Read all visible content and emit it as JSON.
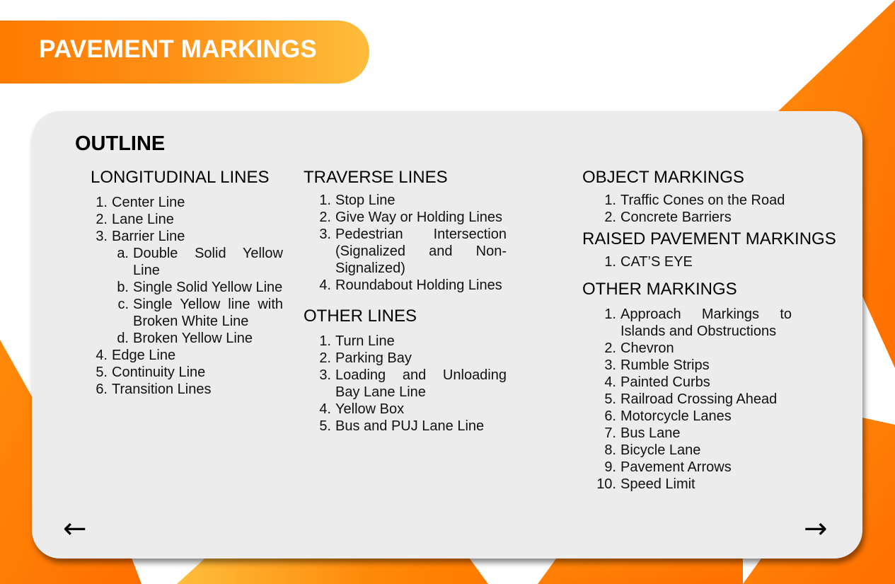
{
  "header": {
    "title": "PAVEMENT MARKINGS"
  },
  "outline": {
    "title": "OUTLINE",
    "longitudinal": {
      "heading": "LONGITUDINAL LINES",
      "items": [
        {
          "num": "1.",
          "text": "Center Line"
        },
        {
          "num": "2.",
          "text": "Lane Line"
        },
        {
          "num": "3.",
          "text": "Barrier Line"
        },
        {
          "num": "4.",
          "text": "Edge Line"
        },
        {
          "num": "5.",
          "text": "Continuity Line"
        },
        {
          "num": "6.",
          "text": "Transition Lines"
        }
      ],
      "subitems": [
        {
          "num": "a.",
          "text": "Double Solid Yellow Line"
        },
        {
          "num": "b.",
          "text": "Single Solid Yellow Line"
        },
        {
          "num": "c.",
          "text": "Single Yellow line with Broken White Line"
        },
        {
          "num": "d.",
          "text": "Broken Yellow Line"
        }
      ]
    },
    "traverse": {
      "heading": "TRAVERSE LINES",
      "items": [
        {
          "num": "1.",
          "text": "Stop Line"
        },
        {
          "num": "2.",
          "text": "Give Way or Holding Lines"
        },
        {
          "num": "3.",
          "text": "Pedestrian Intersection (Signalized and Non-Signalized)"
        },
        {
          "num": "4.",
          "text": "Roundabout Holding Lines"
        }
      ]
    },
    "other_lines": {
      "heading": "OTHER LINES",
      "items": [
        {
          "num": "1.",
          "text": "Turn Line"
        },
        {
          "num": "2.",
          "text": "Parking Bay"
        },
        {
          "num": "3.",
          "text": "Loading and Unloading Bay Lane Line"
        },
        {
          "num": "4.",
          "text": "Yellow Box"
        },
        {
          "num": "5.",
          "text": "Bus and PUJ Lane Line"
        }
      ]
    },
    "object_markings": {
      "heading": "OBJECT MARKINGS",
      "items": [
        {
          "num": "1.",
          "text": "Traffic Cones on the Road"
        },
        {
          "num": "2.",
          "text": "Concrete Barriers"
        }
      ]
    },
    "raised_markings": {
      "heading": "RAISED PAVEMENT MARKINGS",
      "items": [
        {
          "num": "1.",
          "text": "CAT’S EYE"
        }
      ]
    },
    "other_markings": {
      "heading": "OTHER MARKINGS",
      "items": [
        {
          "num": "1.",
          "text": "Approach Markings to Islands and Obstructions"
        },
        {
          "num": "2.",
          "text": "Chevron"
        },
        {
          "num": "3.",
          "text": "Rumble Strips"
        },
        {
          "num": "4.",
          "text": "Painted Curbs"
        },
        {
          "num": "5.",
          "text": "Railroad Crossing Ahead"
        },
        {
          "num": "6.",
          "text": "Motorcycle Lanes"
        },
        {
          "num": "7.",
          "text": "Bus Lane"
        },
        {
          "num": "8.",
          "text": "Bicycle Lane"
        },
        {
          "num": "9.",
          "text": "Pavement Arrows"
        },
        {
          "num": "10.",
          "text": "Speed Limit"
        }
      ]
    }
  },
  "nav": {
    "prev_icon": "←",
    "next_icon": "→"
  },
  "colors": {
    "accent_orange": "#ff7b00",
    "accent_yellow": "#ffbd3c",
    "card_bg": "#ececec"
  }
}
